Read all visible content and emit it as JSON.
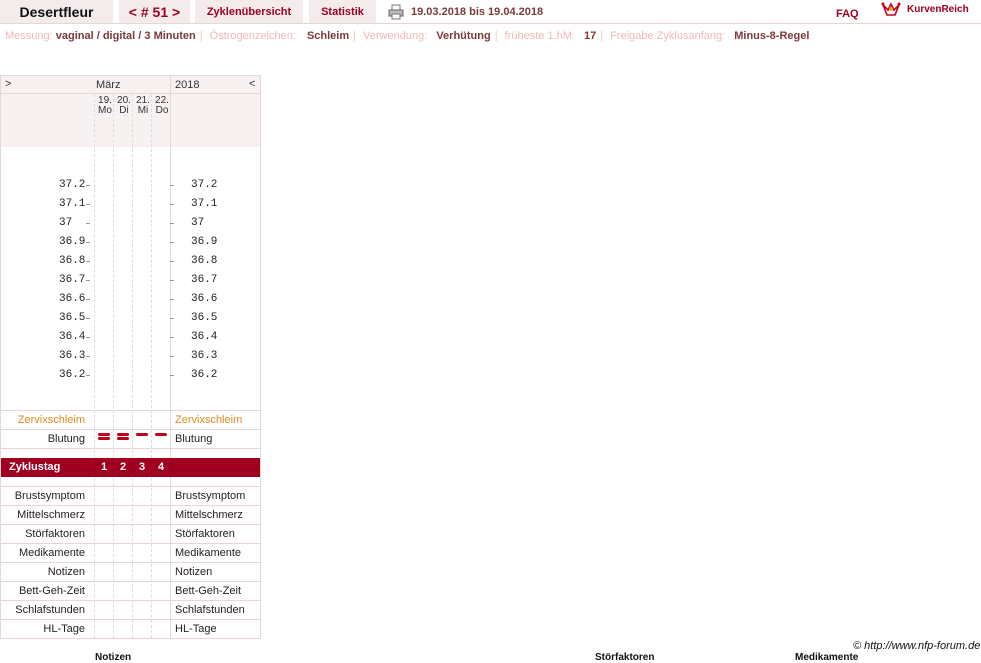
{
  "header": {
    "user": "Desertfleur",
    "cycle": "< # 51 >",
    "overview": "Zyklenübersicht",
    "stats": "Statistik",
    "daterange": "19.03.2018 bis 19.04.2018",
    "faq": "FAQ",
    "logo": "KurvenReich"
  },
  "info": [
    {
      "label": "Messung:",
      "value": "vaginal / digital / 3 Minuten"
    },
    {
      "label": "Östrogenzeichen:",
      "value": "Schleim"
    },
    {
      "label": "Verwendung:",
      "value": "Verhütung"
    },
    {
      "label": "früheste 1.hM:",
      "value": "17"
    },
    {
      "label": "Freigabe Zyklusanfang:",
      "value": "Minus-8-Regel"
    }
  ],
  "chart": {
    "nav_prev": ">",
    "month": "März",
    "year": "2018",
    "nav_next": "<",
    "days": [
      {
        "date": "19.",
        "wd": "Mo"
      },
      {
        "date": "20.",
        "wd": "Di"
      },
      {
        "date": "21.",
        "wd": "Mi"
      },
      {
        "date": "22.",
        "wd": "Do"
      }
    ],
    "temps": [
      "37.2",
      "37.1",
      "37",
      "36.9",
      "36.8",
      "36.7",
      "36.6",
      "36.5",
      "36.4",
      "36.3",
      "36.2"
    ],
    "rows": {
      "cervix": "Zervixschleim",
      "bleeding": "Blutung",
      "cycleday": "Zyklustag",
      "breast": "Brustsymptom",
      "midpain": "Mittelschmerz",
      "disturb": "Störfaktoren",
      "meds": "Medikamente",
      "notes": "Notizen",
      "bedtime": "Bett-Geh-Zeit",
      "sleep": "Schlafstunden",
      "hl": "HL-Tage"
    },
    "cycle_days": [
      "1",
      "2",
      "3",
      "4"
    ],
    "bleeding_levels": [
      2,
      2,
      1,
      1
    ]
  },
  "footer": {
    "copyright": "© http://www.nfp-forum.de",
    "col_notes": "Notizen",
    "col_disturb": "Störfaktoren",
    "col_meds": "Medikamente"
  }
}
